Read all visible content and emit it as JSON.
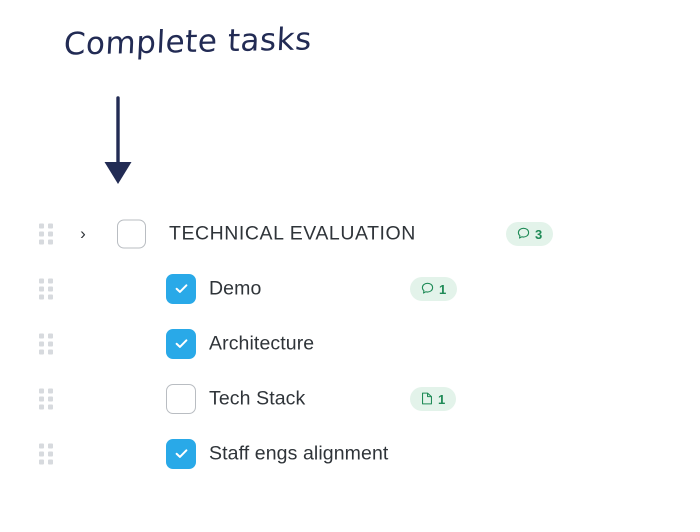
{
  "annotation": {
    "note_text": "Complete tasks",
    "note_color": "#222b54",
    "arrow_name": "down-arrow",
    "arrow_color": "#222b54"
  },
  "colors": {
    "checkbox_checked": "#29a9e8",
    "checkbox_border": "#b9bdc2",
    "badge_background": "#e3f3ea",
    "badge_text": "#1e8a56",
    "label_text": "#2f3439",
    "drag_handle_dot": "#d7dade",
    "page_background": "#ffffff"
  },
  "task_list": {
    "rows": [
      {
        "label": "TECHNICAL EVALUATION",
        "level": "parent",
        "checked": false,
        "has_chevron": true,
        "chevron_glyph": "›",
        "chevron_state": "collapsed",
        "badge": {
          "icon": "comment-icon",
          "count": "3"
        }
      },
      {
        "label": "Demo",
        "level": "child",
        "checked": true,
        "has_chevron": false,
        "badge": {
          "icon": "comment-icon",
          "count": "1"
        }
      },
      {
        "label": "Architecture",
        "level": "child",
        "checked": true,
        "has_chevron": false,
        "badge": null
      },
      {
        "label": "Tech Stack",
        "level": "child",
        "checked": false,
        "has_chevron": false,
        "badge": {
          "icon": "document-icon",
          "count": "1"
        }
      },
      {
        "label": "Staff engs alignment",
        "level": "child",
        "checked": true,
        "has_chevron": false,
        "badge": null
      }
    ]
  }
}
